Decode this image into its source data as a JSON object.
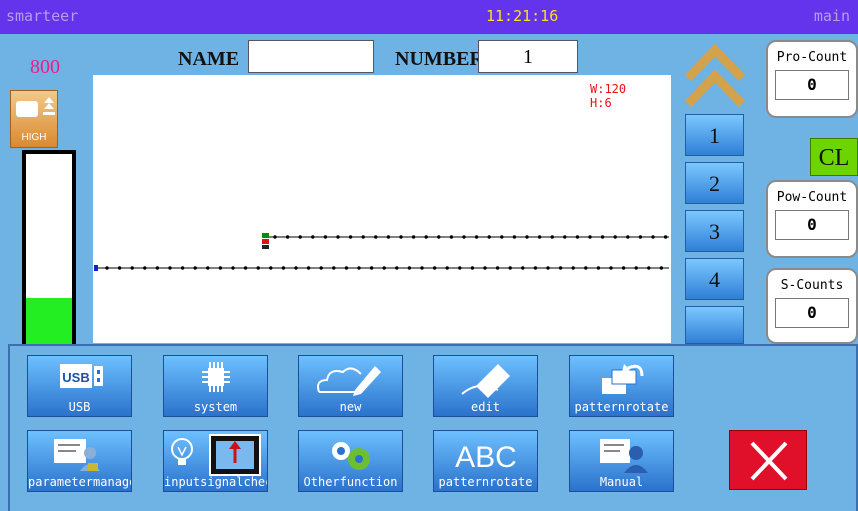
{
  "header": {
    "app_name": "smarteer",
    "time": "11:21:16",
    "mode": "main"
  },
  "left": {
    "speed_value": "800",
    "speed_button_label": "HIGH",
    "speed_level": 0.24
  },
  "form": {
    "name_label": "NAME",
    "name_value": "",
    "number_label": "NUMBER",
    "number_value": "1"
  },
  "pattern": {
    "width_label": "W:120",
    "height_label": "H:6"
  },
  "side_numbers": [
    "1",
    "2",
    "3",
    "4"
  ],
  "counters": {
    "pro": {
      "label": "Pro-Count",
      "value": "0"
    },
    "clear_label": "CL",
    "pow": {
      "label": "Pow-Count",
      "value": "0"
    },
    "s": {
      "label": "S-Counts",
      "value": "0"
    }
  },
  "toolbar": {
    "row1": [
      {
        "label": "USB",
        "icon": "usb-icon"
      },
      {
        "label": "system",
        "icon": "chip-icon"
      },
      {
        "label": "new",
        "icon": "pen-cloud-icon"
      },
      {
        "label": "edit",
        "icon": "eraser-icon"
      },
      {
        "label": "patternrotate",
        "icon": "rotate-windows-icon"
      }
    ],
    "row2": [
      {
        "label": "parametermanage",
        "icon": "document-user-lock-icon"
      },
      {
        "label": "inputsignalcheck",
        "icon": "bulb-chip-icon"
      },
      {
        "label": "Otherfunction",
        "icon": "gears-icon"
      },
      {
        "label": "patternrotate",
        "icon": "abc-icon"
      },
      {
        "label": "Manual",
        "icon": "document-user-icon"
      }
    ]
  },
  "usb_icon_text": "USB",
  "abc_icon_text": "ABC",
  "colors": {
    "topbar": "#6433ec",
    "header_text": "#ffdf23",
    "background": "#6fb3e4",
    "close_button": "#e0102a",
    "speed_fill": "#22ee22",
    "speed_number": "#ee1b8b",
    "cl_button": "#6cd400",
    "dims_text": "#ee1111"
  }
}
